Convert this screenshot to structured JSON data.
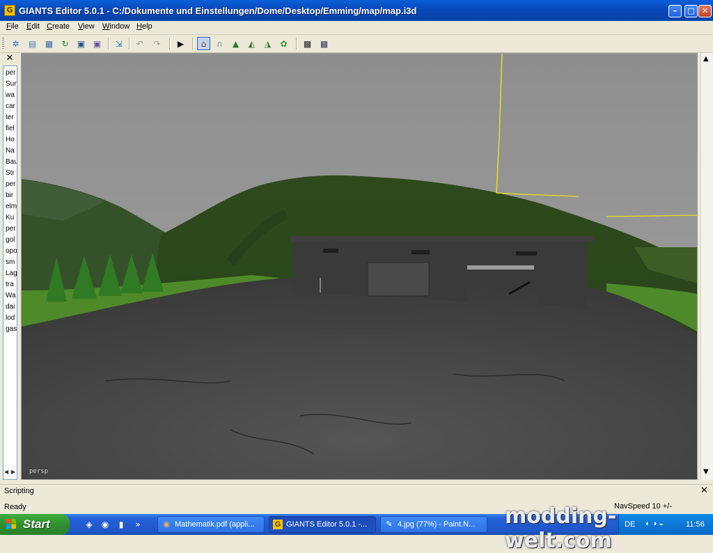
{
  "window": {
    "title": "GIANTS Editor 5.0.1 - C:/Dokumente und Einstellungen/Dome/Desktop/Emming/map/map.i3d",
    "app_icon": "giants-app-icon",
    "minimize_glyph": "–",
    "maximize_glyph": "□",
    "close_glyph": "✕"
  },
  "menu": {
    "items": [
      {
        "label": "File",
        "key": "F",
        "rest": "ile"
      },
      {
        "label": "Edit",
        "key": "E",
        "rest": "dit"
      },
      {
        "label": "Create",
        "key": "C",
        "rest": "reate"
      },
      {
        "label": "View",
        "key": "V",
        "rest": "iew"
      },
      {
        "label": "Window",
        "key": "W",
        "rest": "indow"
      },
      {
        "label": "Help",
        "key": "H",
        "rest": "elp"
      }
    ]
  },
  "toolbar": {
    "buttons": [
      {
        "icon": "new-scene-icon",
        "glyph": "✲",
        "color": "#2a6fd6"
      },
      {
        "icon": "open-icon",
        "glyph": "▤",
        "color": "#4a7fb8"
      },
      {
        "icon": "document-icon",
        "glyph": "▦",
        "color": "#3b6aa8"
      },
      {
        "icon": "reload-icon",
        "glyph": "↻",
        "color": "#1d8a3a"
      },
      {
        "icon": "save-icon",
        "glyph": "▣",
        "color": "#2b4f8f"
      },
      {
        "icon": "save-as-icon",
        "glyph": "▣",
        "color": "#6a4f9f"
      },
      {
        "icon": "import-icon",
        "glyph": "⇲",
        "color": "#2d6ec7"
      },
      {
        "icon": "undo-icon",
        "glyph": "↶",
        "color": "#9a9a9a"
      },
      {
        "icon": "redo-icon",
        "glyph": "↷",
        "color": "#9a9a9a"
      },
      {
        "icon": "play-icon",
        "glyph": "▶",
        "color": "#000000"
      },
      {
        "icon": "home-icon",
        "glyph": "⌂",
        "color": "#7a4a1a"
      },
      {
        "icon": "magnet-icon",
        "glyph": "∩",
        "color": "#8a8a8a"
      },
      {
        "icon": "terrain-paint-icon",
        "glyph": "▲",
        "color": "#2c7a2c"
      },
      {
        "icon": "terrain-sculpt-icon",
        "glyph": "◭",
        "color": "#2c6a2c"
      },
      {
        "icon": "terrain-smooth-icon",
        "glyph": "◮",
        "color": "#3a7a3a"
      },
      {
        "icon": "foliage-icon",
        "glyph": "✿",
        "color": "#2f9a2f"
      },
      {
        "icon": "checker-icon",
        "glyph": "▩",
        "color": "#222222"
      },
      {
        "icon": "checker-search-icon",
        "glyph": "▩",
        "color": "#333366"
      }
    ]
  },
  "left_panel": {
    "close_glyph": "✕",
    "items": [
      "per",
      "Sur",
      "wa",
      "car",
      "ter",
      "fiel",
      "Ho",
      "Na",
      "Bau",
      "Str",
      "per",
      "bir",
      "elm",
      "Ku",
      "per",
      "gol",
      "opo",
      "sm",
      "Lag",
      "tra",
      "Wa",
      "dai",
      "lod",
      "gas"
    ]
  },
  "viewport": {
    "camera_label": "persp",
    "colors": {
      "sky": "#8f8f8f",
      "hill": "#2f4a1e",
      "road": "#4a4a4a",
      "grass": "#4f8a2a"
    }
  },
  "scripting": {
    "label": "Scripting",
    "close_glyph": "✕"
  },
  "status": {
    "text": "Ready",
    "navspeed": "NavSpeed 10 +/-"
  },
  "taskbar": {
    "start_label": "Start",
    "tasks": [
      {
        "label": "Mathematik.pdf (appli...",
        "icon": "firefox-icon",
        "glyph": "◉",
        "active": false
      },
      {
        "label": "GIANTS Editor 5.0.1 -...",
        "icon": "giants-app-icon",
        "glyph": "G",
        "active": true
      },
      {
        "label": "4.jpg (77%) - Paint.N...",
        "icon": "paint-icon",
        "glyph": "✎",
        "active": false
      }
    ],
    "quick_glyphs": [
      "◈",
      "◉",
      "▮",
      "»"
    ],
    "tray": {
      "lang": "DE",
      "icons": "◐◑◒",
      "clock": "11:56"
    }
  },
  "watermark": "modding-welt.com"
}
